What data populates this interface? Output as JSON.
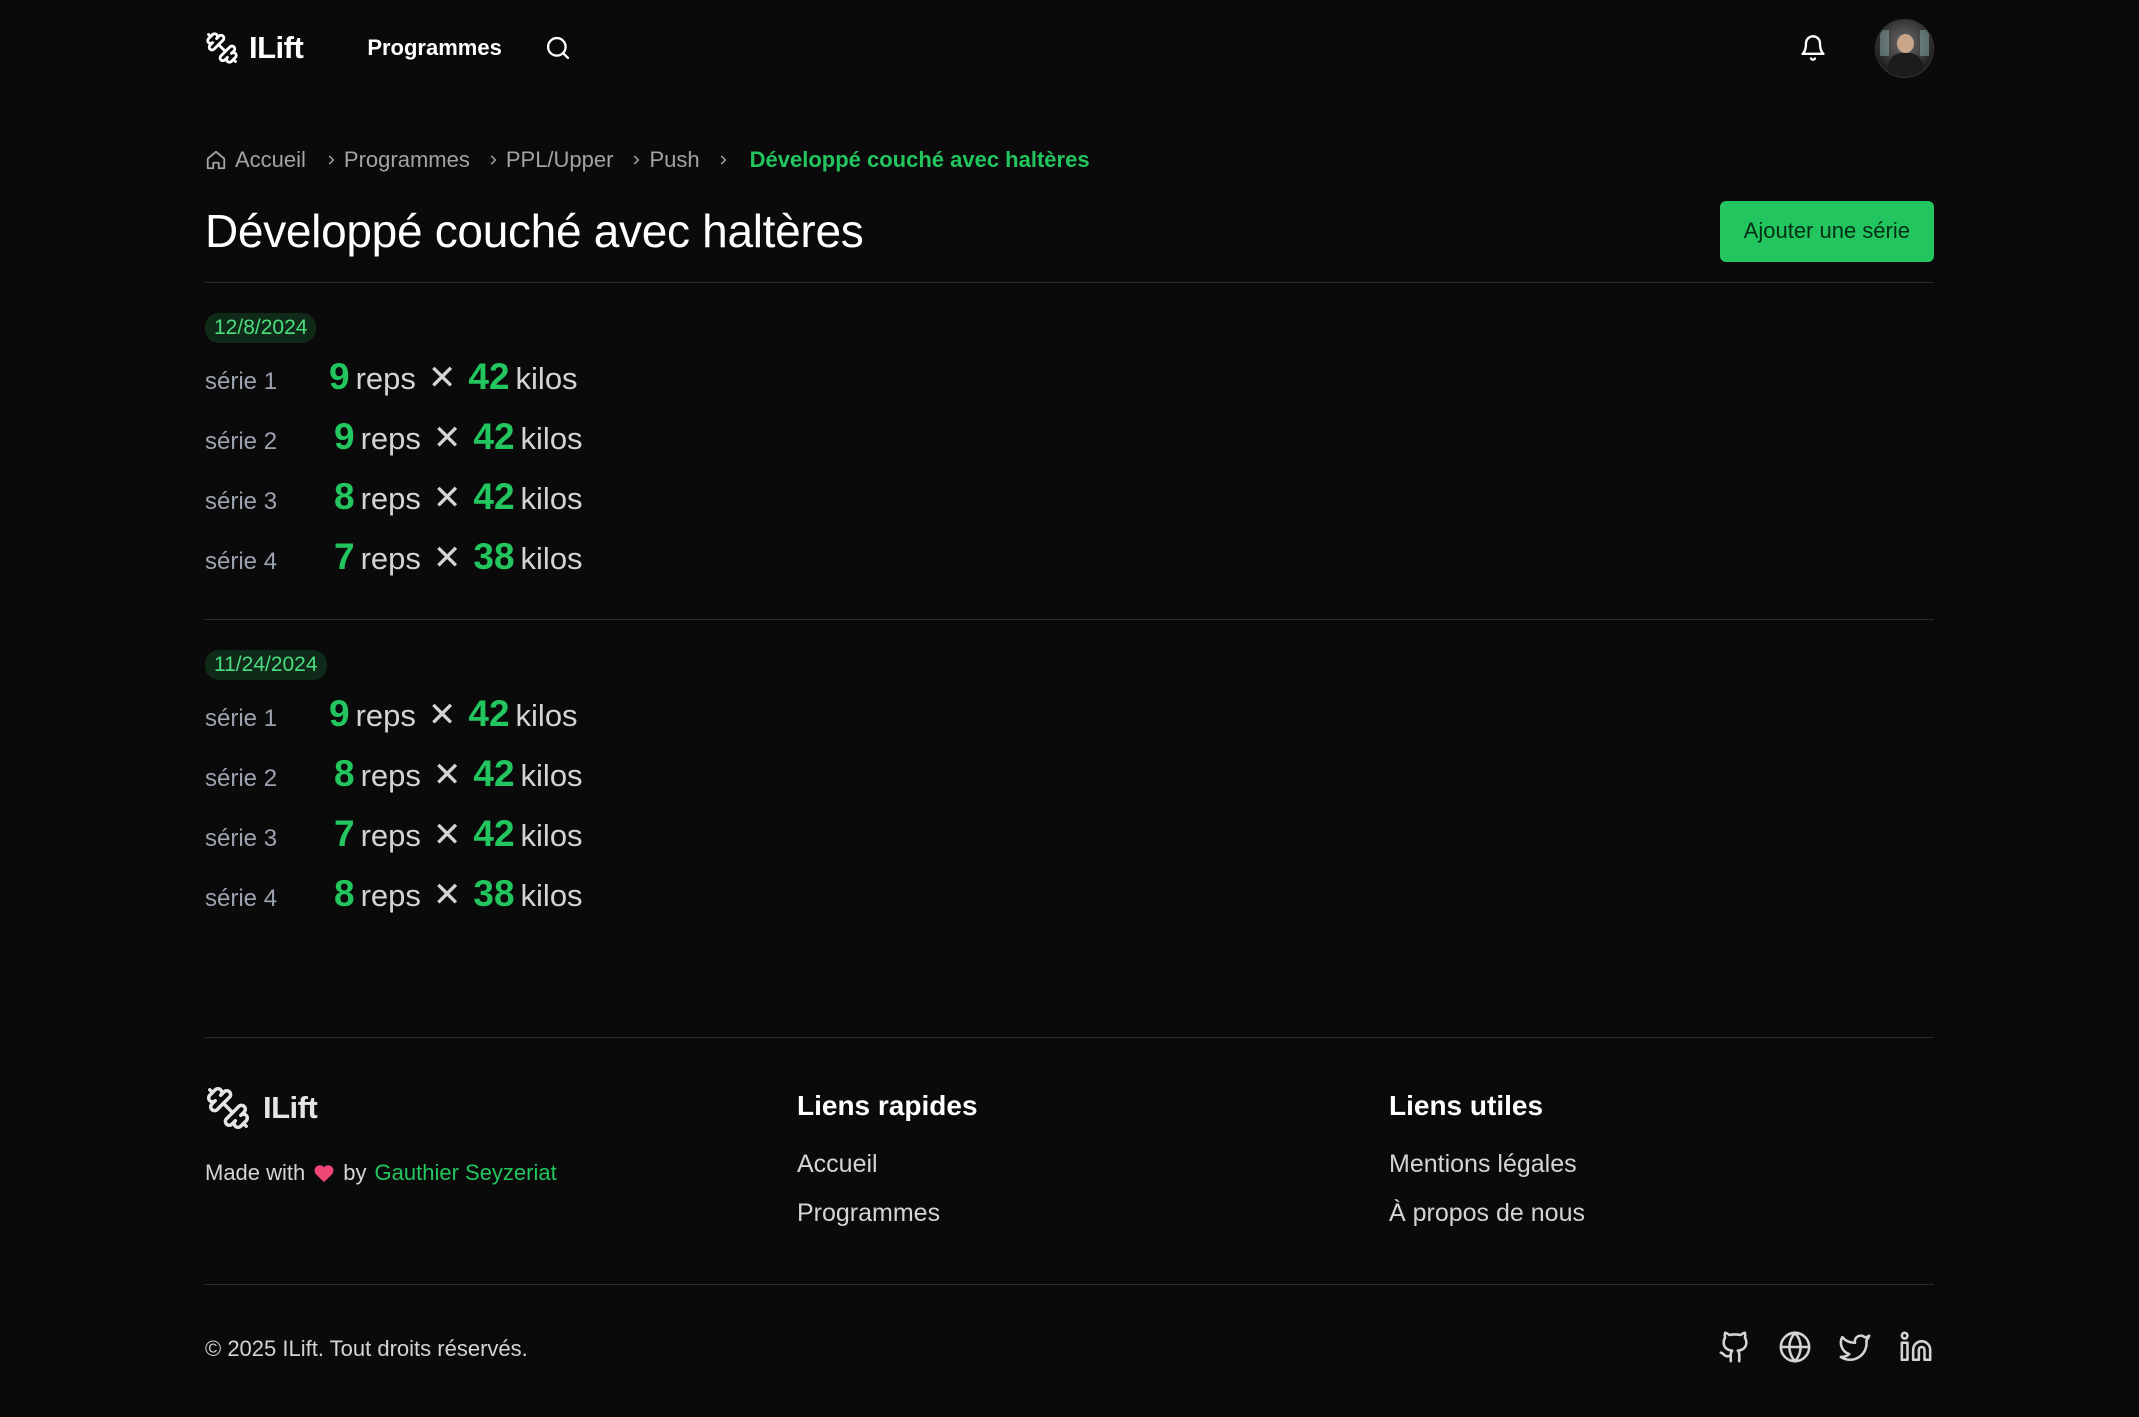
{
  "colors": {
    "accent": "#22c55e",
    "background": "#0a0a0a",
    "muted": "#a3a3a3"
  },
  "header": {
    "brand": "ILift",
    "nav_programmes": "Programmes",
    "search_icon": "search-icon",
    "bell_icon": "bell-icon"
  },
  "breadcrumb": {
    "home": "Accueil",
    "items": [
      "Programmes",
      "PPL/Upper",
      "Push"
    ],
    "current": "Développé couché avec haltères"
  },
  "page": {
    "title": "Développé couché avec haltères",
    "add_button": "Ajouter une série"
  },
  "units": {
    "reps": "reps",
    "kilos": "kilos",
    "times": "✕"
  },
  "sessions": [
    {
      "date": "12/8/2024",
      "sets": [
        {
          "label": "série 1",
          "reps": "9",
          "kilos": "42"
        },
        {
          "label": "série 2",
          "reps": "9",
          "kilos": "42"
        },
        {
          "label": "série 3",
          "reps": "8",
          "kilos": "42"
        },
        {
          "label": "série 4",
          "reps": "7",
          "kilos": "38"
        }
      ]
    },
    {
      "date": "11/24/2024",
      "sets": [
        {
          "label": "série 1",
          "reps": "9",
          "kilos": "42"
        },
        {
          "label": "série 2",
          "reps": "8",
          "kilos": "42"
        },
        {
          "label": "série 3",
          "reps": "7",
          "kilos": "42"
        },
        {
          "label": "série 4",
          "reps": "8",
          "kilos": "38"
        }
      ]
    }
  ],
  "footer": {
    "brand": "ILift",
    "made_with": "Made with",
    "by": "by",
    "author": "Gauthier Seyzeriat",
    "quick_links_title": "Liens rapides",
    "quick_links": [
      "Accueil",
      "Programmes"
    ],
    "useful_links_title": "Liens utiles",
    "useful_links": [
      "Mentions légales",
      "À propos de nous"
    ],
    "copyright": "© 2025 ILift. Tout droits réservés.",
    "socials": [
      "github-icon",
      "globe-icon",
      "twitter-icon",
      "linkedin-icon"
    ]
  }
}
